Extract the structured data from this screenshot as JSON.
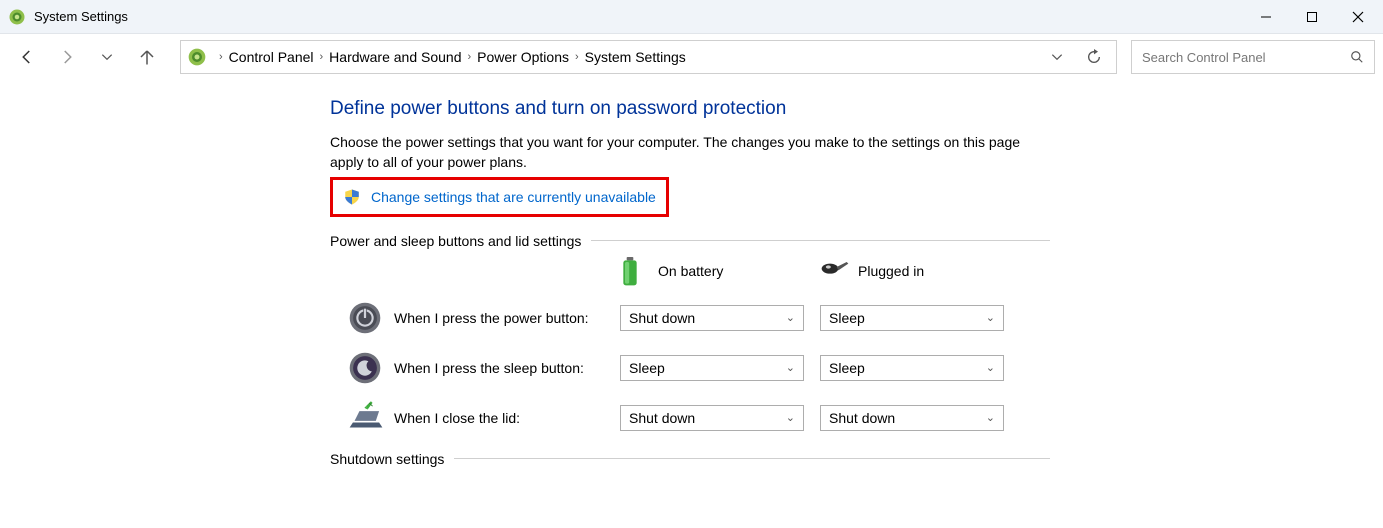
{
  "window": {
    "title": "System Settings"
  },
  "breadcrumb": {
    "items": [
      "Control Panel",
      "Hardware and Sound",
      "Power Options",
      "System Settings"
    ]
  },
  "search": {
    "placeholder": "Search Control Panel"
  },
  "page": {
    "title": "Define power buttons and turn on password protection",
    "subtitle": "Choose the power settings that you want for your computer. The changes you make to the settings on this page apply to all of your power plans.",
    "uac_link": "Change settings that are currently unavailable"
  },
  "sections": {
    "power_buttons": "Power and sleep buttons and lid settings",
    "shutdown": "Shutdown settings"
  },
  "columns": {
    "battery": "On battery",
    "plugged": "Plugged in"
  },
  "rows": {
    "power": {
      "label": "When I press the power button:",
      "battery": "Shut down",
      "plugged": "Sleep"
    },
    "sleep": {
      "label": "When I press the sleep button:",
      "battery": "Sleep",
      "plugged": "Sleep"
    },
    "lid": {
      "label": "When I close the lid:",
      "battery": "Shut down",
      "plugged": "Shut down"
    }
  }
}
